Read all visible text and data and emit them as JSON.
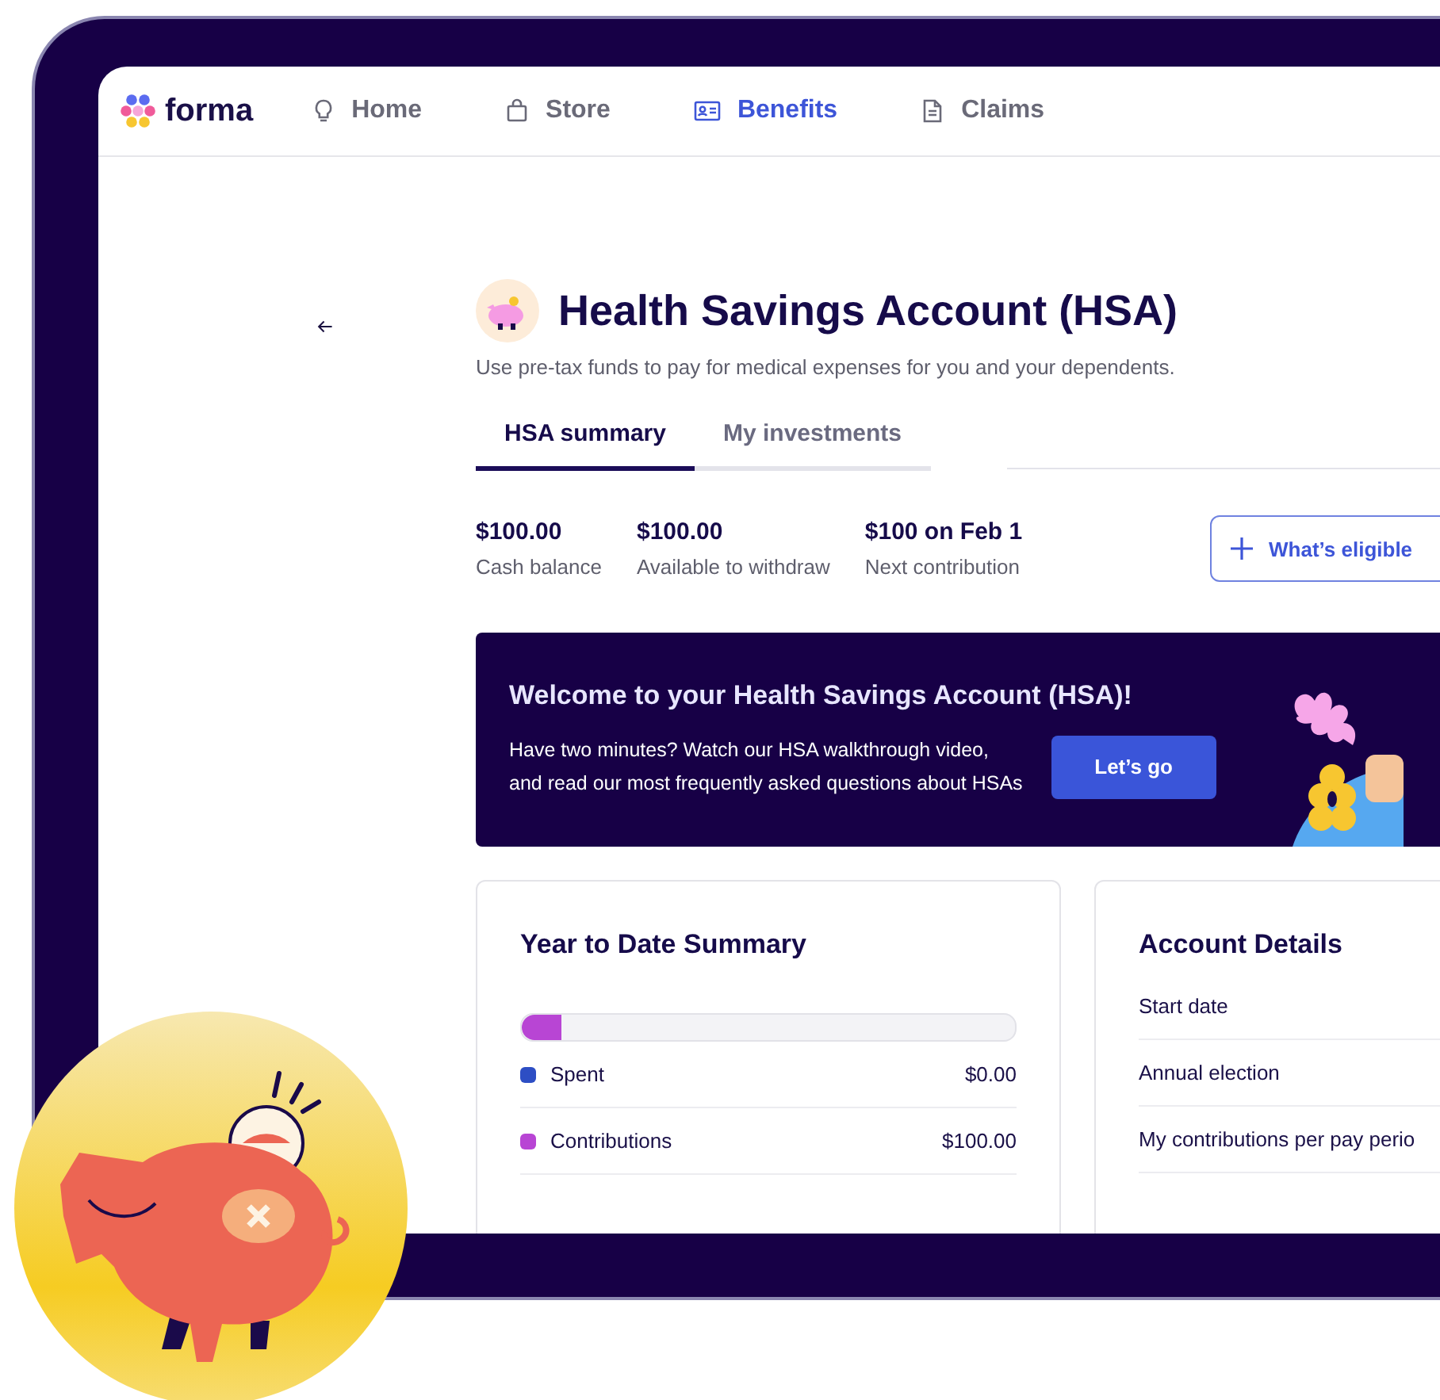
{
  "nav": {
    "logo": "forma",
    "items": [
      {
        "label": "Home",
        "selected": false
      },
      {
        "label": "Store",
        "selected": false
      },
      {
        "label": "Benefits",
        "selected": true
      },
      {
        "label": "Claims",
        "selected": false
      }
    ]
  },
  "page": {
    "title": "Health Savings Account (HSA)",
    "subtitle": "Use pre-tax funds to pay for medical expenses for you and your dependents."
  },
  "tabs": [
    {
      "label": "HSA summary",
      "selected": true
    },
    {
      "label": "My investments",
      "selected": false
    }
  ],
  "stats": [
    {
      "value": "$100.00",
      "label": "Cash balance"
    },
    {
      "value": "$100.00",
      "label": "Available to withdraw"
    },
    {
      "value": "$100 on Feb 1",
      "label": "Next contribution"
    }
  ],
  "eligible_button": "What’s eligible",
  "banner": {
    "title": "Welcome to your Health Savings Account (HSA)!",
    "text": "Have two minutes? Watch our HSA walkthrough video,\nand read our most frequently asked questions about HSAs",
    "button": "Let’s go"
  },
  "ytd": {
    "title": "Year to Date Summary",
    "level": 0.08,
    "rows": [
      {
        "label": "Spent",
        "amount": "$0.00",
        "color": "#2d4ec4"
      },
      {
        "label": "Contributions",
        "amount": "$100.00",
        "color": "#b845d4"
      }
    ]
  },
  "account": {
    "title": "Account Details",
    "rows": [
      "Start date",
      "Annual election",
      "My contributions per pay perio"
    ]
  }
}
